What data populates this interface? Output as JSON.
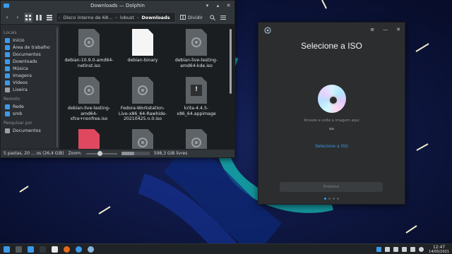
{
  "dolphin": {
    "title": "Downloads — Dolphin",
    "breadcrumb": {
      "segments": [
        "Disco interno de 68...",
        "lobust"
      ],
      "current": "Downloads"
    },
    "split_label": "Dividir",
    "places": {
      "section_places": "Locais",
      "items": [
        {
          "label": "Início",
          "icon": "home-icon",
          "color": "#3d9ae8"
        },
        {
          "label": "Área de trabalho",
          "icon": "desktop-icon",
          "color": "#3d9ae8"
        },
        {
          "label": "Documentos",
          "icon": "documents-icon",
          "color": "#3d9ae8"
        },
        {
          "label": "Downloads",
          "icon": "downloads-icon",
          "color": "#3d9ae8"
        },
        {
          "label": "Música",
          "icon": "music-icon",
          "color": "#3d9ae8"
        },
        {
          "label": "Imagens",
          "icon": "pictures-icon",
          "color": "#3d9ae8"
        },
        {
          "label": "Vídeos",
          "icon": "videos-icon",
          "color": "#3d9ae8"
        },
        {
          "label": "Lixeira",
          "icon": "trash-icon",
          "color": "#9aa0a4"
        }
      ],
      "section_remote": "Remoto",
      "remote_items": [
        {
          "label": "Rede",
          "icon": "network-icon",
          "color": "#3d9ae8"
        },
        {
          "label": "smb",
          "icon": "network-folder-icon",
          "color": "#3d9ae8"
        }
      ],
      "section_search": "Pesquisar por",
      "search_items": [
        {
          "label": "Documentos",
          "icon": "search-documents-icon",
          "color": "#9aa0a4"
        }
      ]
    },
    "files": [
      {
        "name": "debian-10.9.0-amd64-netinst.iso",
        "kind": "iso"
      },
      {
        "name": "debian-binary",
        "kind": "text"
      },
      {
        "name": "debian-live-testing-amd64-kde.iso",
        "kind": "iso"
      },
      {
        "name": "debian-live-testing-amd64-xfce+nonfree.iso",
        "kind": "iso"
      },
      {
        "name": "Fedora-Workstation-Live-x86_64-Rawhide-20210425.n.0.iso",
        "kind": "iso"
      },
      {
        "name": "krita-4.4.5-x86_64.appimage",
        "kind": "appimage"
      },
      {
        "name": "",
        "kind": "archive"
      },
      {
        "name": "",
        "kind": "iso"
      },
      {
        "name": "",
        "kind": "iso"
      }
    ],
    "status": {
      "summary": "5 pastas, 20 ... os (26,4 GiB)",
      "zoom_label": "Zoom:",
      "zoom_level": 0.4,
      "free_space": "598,3 GiB livres",
      "used_fraction": 0.45
    }
  },
  "iso": {
    "title": "Selecione a ISO",
    "controls": {
      "menu": "≡",
      "minimize": "—",
      "close": "✕"
    },
    "hint": "Arraste e solte a imagem aqui",
    "or": "ou",
    "select_link": "Selecione a ISO",
    "next_button": "Próximo",
    "pages": 4,
    "current_page": 0,
    "accent": "#3d9ae8"
  },
  "taskbar": {
    "apps": [
      {
        "icon": "app-launcher-icon",
        "color": "#3d9ae8"
      },
      {
        "icon": "pager-icon",
        "color": "#55595c"
      },
      {
        "icon": "dolphin-icon",
        "color": "#3d9ae8"
      },
      {
        "icon": "terminal-icon",
        "color": "#31363b"
      },
      {
        "icon": "text-editor-icon",
        "color": "#e8e8e8"
      },
      {
        "icon": "firefox-icon",
        "color": "#e66a1e"
      },
      {
        "icon": "browser-icon",
        "color": "#3d9ae8"
      },
      {
        "icon": "iso-writer-icon",
        "color": "#8ab4d8"
      }
    ],
    "clock": {
      "time": "12:47",
      "date": "14/05/2021"
    }
  }
}
